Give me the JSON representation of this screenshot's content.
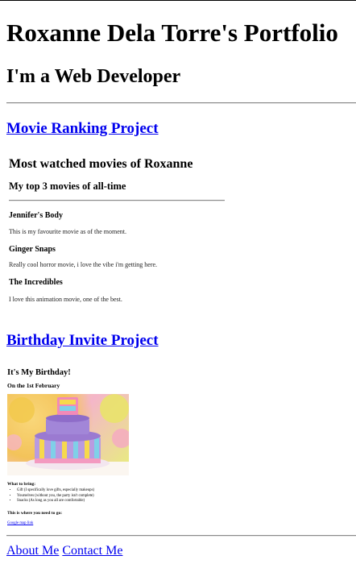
{
  "header": {
    "title": "Roxanne Dela Torre's Portfolio",
    "subtitle": "I'm a Web Developer"
  },
  "projects": [
    {
      "link": "Movie Ranking Project"
    },
    {
      "link": "Birthday Invite Project"
    }
  ],
  "movie_preview": {
    "title": "Most watched movies of Roxanne",
    "subtitle": "My top 3 movies of all-time",
    "movies": [
      {
        "name": "Jennifer's Body",
        "description": "This is my favourite movie as of the moment."
      },
      {
        "name": "Ginger Snaps",
        "description": "Really cool horror movie, i love the vibe i'm getting here."
      },
      {
        "name": "The Incredibles",
        "description": "I love this animation movie, one of the best."
      }
    ]
  },
  "birthday_preview": {
    "title": "It's My Birthday!",
    "date": "On the 1st February",
    "what_to_bring_label": "What to bring:",
    "items": [
      "Gift (I specifically love gifts, especially makeups)",
      "Yourselves (without you, the party isn't complete)",
      "Snacks (As long as you all are comfortable)"
    ],
    "location_label": "This is where you need to go:",
    "map_link": "Google map link",
    "image_alt": "birthday cake"
  },
  "footer": {
    "about_label": "About Me",
    "contact_label": "Contact Me"
  },
  "colors": {
    "link": "#0000ee",
    "text": "#000000",
    "rule": "#8a8a8a"
  }
}
